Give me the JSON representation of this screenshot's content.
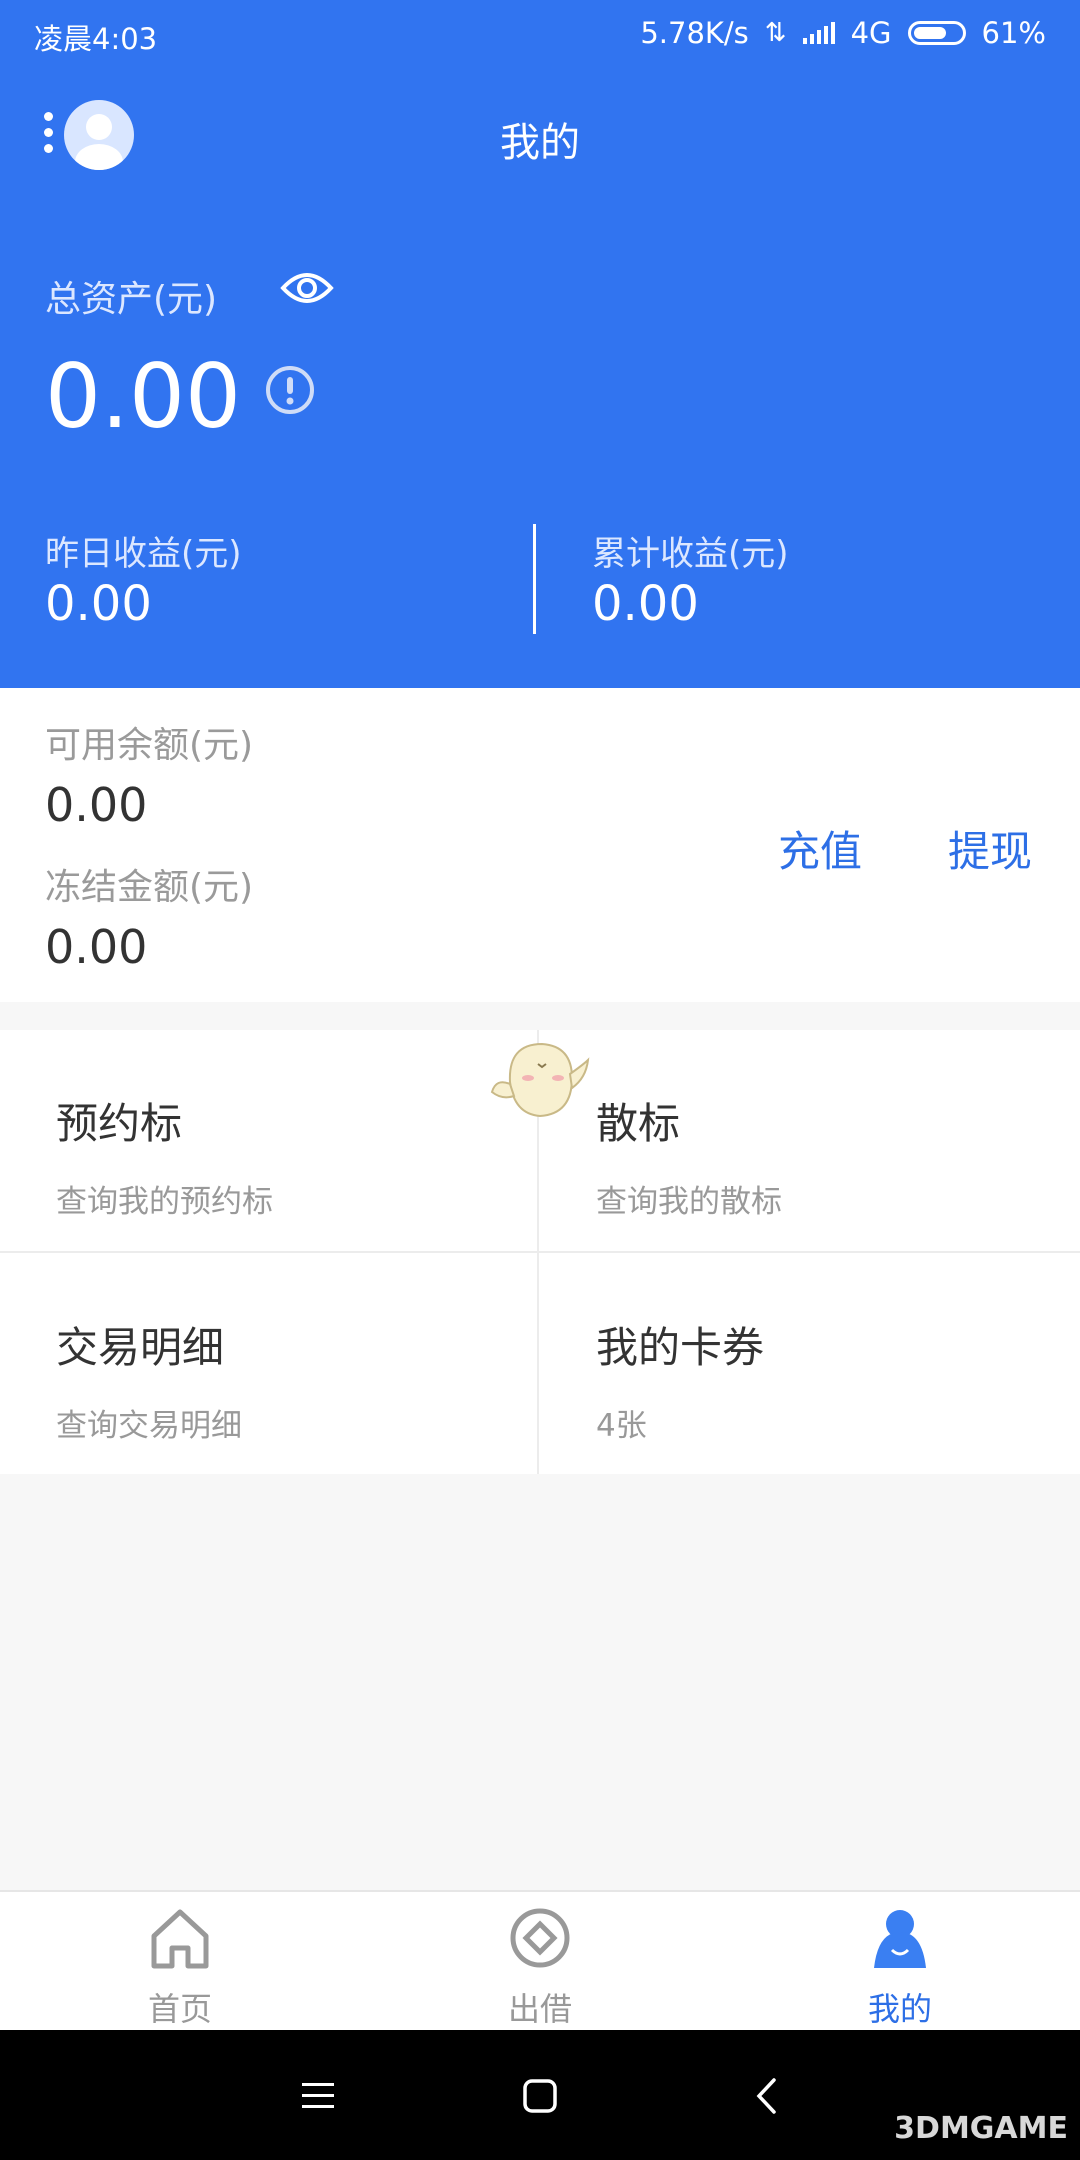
{
  "status_bar": {
    "time": "凌晨4:03",
    "speed": "5.78K/s",
    "network": "4G",
    "battery": "61%"
  },
  "header": {
    "title": "我的"
  },
  "assets": {
    "total_label": "总资产(元)",
    "total_value": "0.00",
    "yesterday_label": "昨日收益(元)",
    "yesterday_value": "0.00",
    "cumulative_label": "累计收益(元)",
    "cumulative_value": "0.00"
  },
  "balance": {
    "available_label": "可用余额(元)",
    "available_value": "0.00",
    "frozen_label": "冻结金额(元)",
    "frozen_value": "0.00",
    "recharge_label": "充值",
    "withdraw_label": "提现"
  },
  "grid": [
    {
      "title": "预约标",
      "subtitle": "查询我的预约标"
    },
    {
      "title": "散标",
      "subtitle": "查询我的散标"
    },
    {
      "title": "交易明细",
      "subtitle": "查询交易明细"
    },
    {
      "title": "我的卡券",
      "subtitle": "4张"
    }
  ],
  "tabs": [
    {
      "label": "首页",
      "icon": "home-icon",
      "active": false
    },
    {
      "label": "出借",
      "icon": "lend-icon",
      "active": false
    },
    {
      "label": "我的",
      "icon": "profile-icon",
      "active": true
    }
  ],
  "watermark": "3DMGAME",
  "colors": {
    "primary": "#3174f0",
    "link": "#2d6fe6",
    "muted": "#999999"
  }
}
